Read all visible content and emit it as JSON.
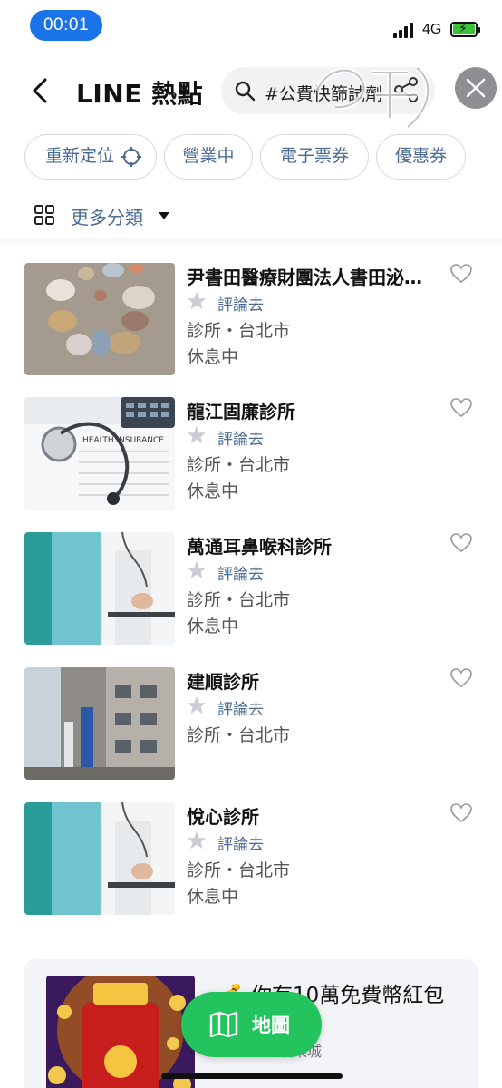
{
  "status_bar": {
    "time": "00:01",
    "network": "4G"
  },
  "header": {
    "title": "LINE 熱點",
    "search_text": "#公費快篩試劑"
  },
  "filters": {
    "relocate": "重新定位",
    "open_now": "營業中",
    "e_ticket": "電子票券",
    "coupon": "優惠券"
  },
  "more_categories": "更多分類",
  "places": [
    {
      "name": "尹書田醫療財團法人書田泌尿科眼科診所",
      "review": "評論去",
      "category": "診所",
      "city": "台北市",
      "meta": "診所・台北市",
      "status": "休息中"
    },
    {
      "name": "龍江固廉診所",
      "review": "評論去",
      "category": "診所",
      "city": "台北市",
      "meta": "診所・台北市",
      "status": "休息中"
    },
    {
      "name": "萬通耳鼻喉科診所",
      "review": "評論去",
      "category": "診所",
      "city": "台北市",
      "meta": "診所・台北市",
      "status": "休息中"
    },
    {
      "name": "建順診所",
      "review": "評論去",
      "category": "診所",
      "city": "台北市",
      "meta": "診所・台北市",
      "status": ""
    },
    {
      "name": "悅心診所",
      "review": "評論去",
      "category": "診所",
      "city": "台北市",
      "meta": "診所・台北市",
      "status": "休息中"
    }
  ],
  "ad": {
    "title": "💰 你有10萬免費幣紅包",
    "subtitle": "娛樂城"
  },
  "map_button": "地圖",
  "colors": {
    "accent_blue": "#1a73e8",
    "link_blue": "#4a6a93",
    "map_green": "#23c45e",
    "battery_green": "#3cc13b"
  }
}
